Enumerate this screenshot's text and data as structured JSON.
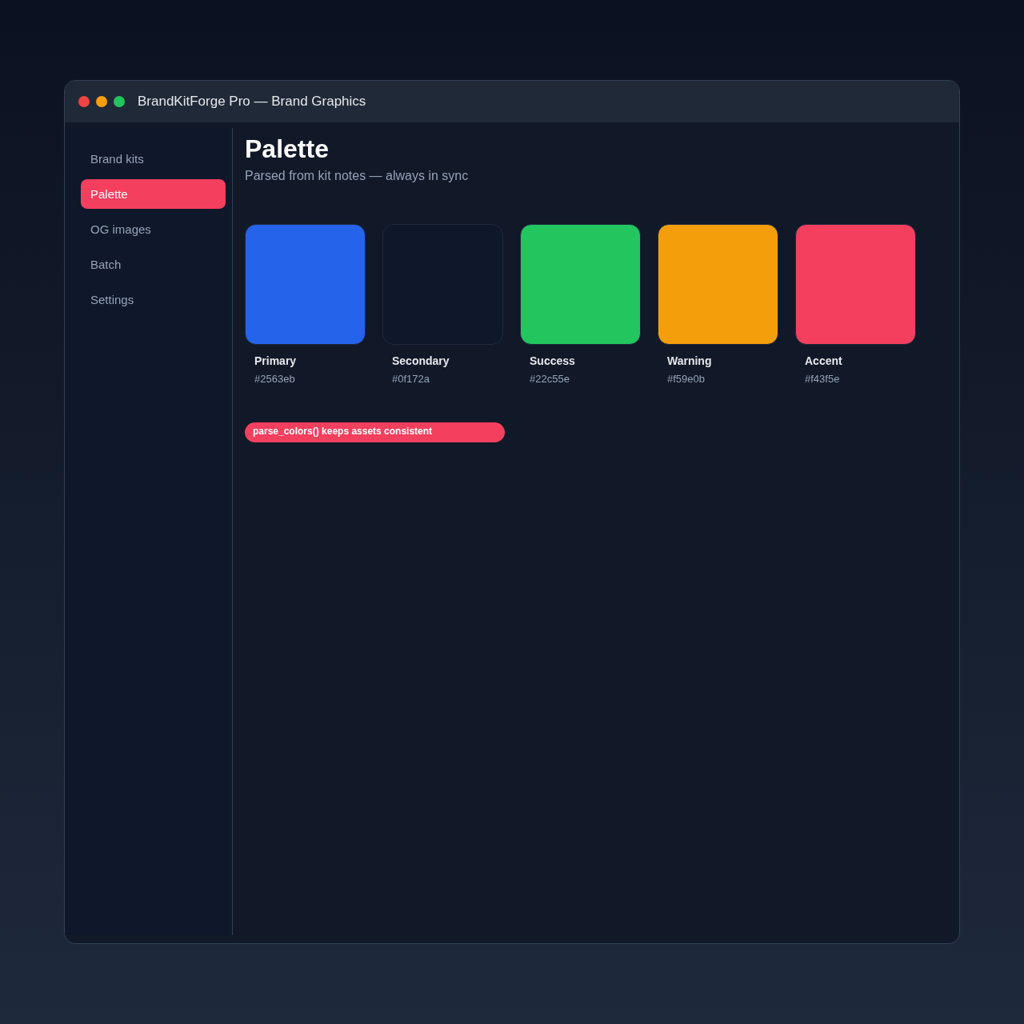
{
  "window": {
    "title": "BrandKitForge Pro — Brand Graphics"
  },
  "sidebar": {
    "items": [
      {
        "label": "Brand kits",
        "selected": false
      },
      {
        "label": "Palette",
        "selected": true
      },
      {
        "label": "OG images",
        "selected": false
      },
      {
        "label": "Batch",
        "selected": false
      },
      {
        "label": "Settings",
        "selected": false
      }
    ]
  },
  "page": {
    "title": "Palette",
    "subtitle": "Parsed from kit notes — always in sync"
  },
  "swatches": [
    {
      "name": "Primary",
      "hex": "#2563eb",
      "color": "#2563eb"
    },
    {
      "name": "Secondary",
      "hex": "#0f172a",
      "color": "#0f172a"
    },
    {
      "name": "Success",
      "hex": "#22c55e",
      "color": "#22c55e"
    },
    {
      "name": "Warning",
      "hex": "#f59e0b",
      "color": "#f59e0b"
    },
    {
      "name": "Accent",
      "hex": "#f43f5e",
      "color": "#f43f5e"
    }
  ],
  "banner": "parse_colors() keeps assets consistent"
}
